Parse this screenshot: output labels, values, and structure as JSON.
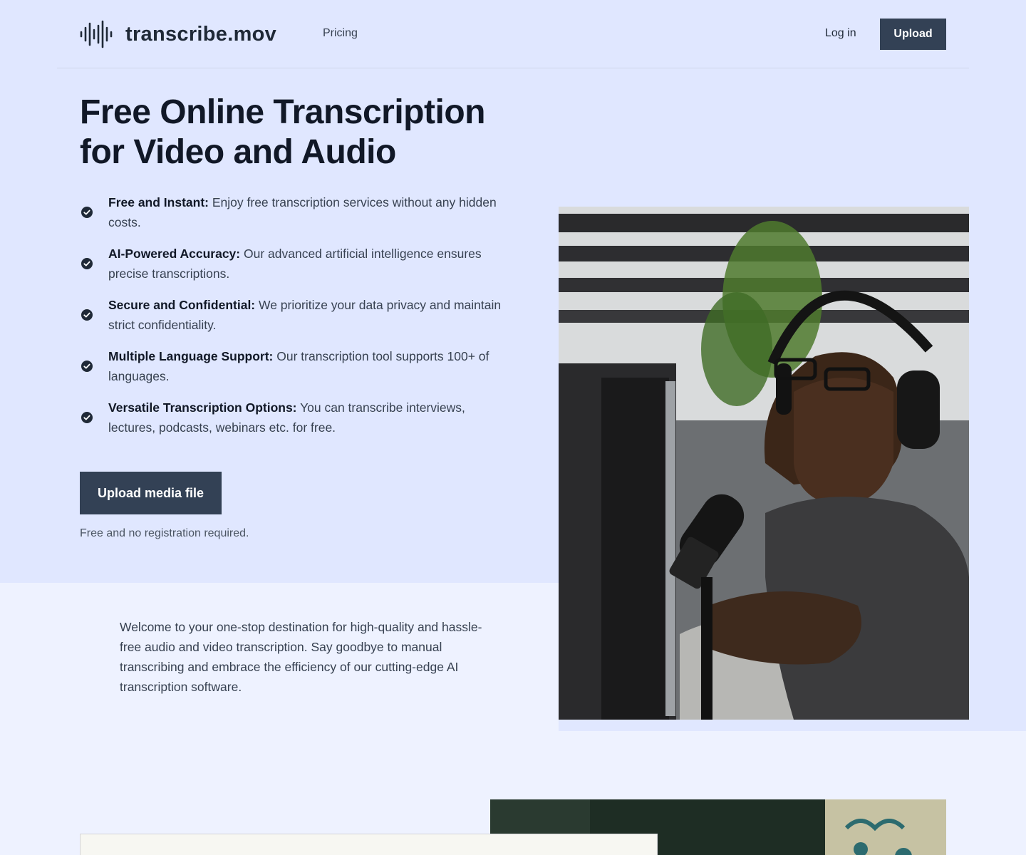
{
  "brand": {
    "name": "transcribe.mov"
  },
  "nav": {
    "pricing": "Pricing",
    "login": "Log in",
    "upload": "Upload"
  },
  "hero": {
    "title_line1": "Free Online Transcription",
    "title_line2": "for Video and Audio",
    "features": [
      {
        "title": "Free and Instant:",
        "text": "Enjoy free transcription services without any hidden costs."
      },
      {
        "title": "AI-Powered Accuracy:",
        "text": "Our advanced artificial intelligence ensures precise transcriptions."
      },
      {
        "title": "Secure and Confidential:",
        "text": "We prioritize your data privacy and maintain strict confidentiality."
      },
      {
        "title": "Multiple Language Support:",
        "text": "Our transcription tool supports 100+ of languages."
      },
      {
        "title": "Versatile Transcription Options:",
        "text": "You can transcribe interviews, lectures, podcasts, webinars etc. for free."
      }
    ],
    "cta": "Upload media file",
    "cta_note": "Free and no registration required."
  },
  "welcome": "Welcome to your one-stop destination for high-quality and hassle-free audio and video transcription. Say goodbye to manual transcribing and embrace the efficiency of our cutting-edge AI transcription software.",
  "icons": {
    "logo": "sound-wave-icon",
    "check": "check-circle-icon"
  },
  "colors": {
    "hero_bg": "#e0e7ff",
    "page_bg": "#eef2ff",
    "button": "#334155",
    "heading": "#111827"
  }
}
